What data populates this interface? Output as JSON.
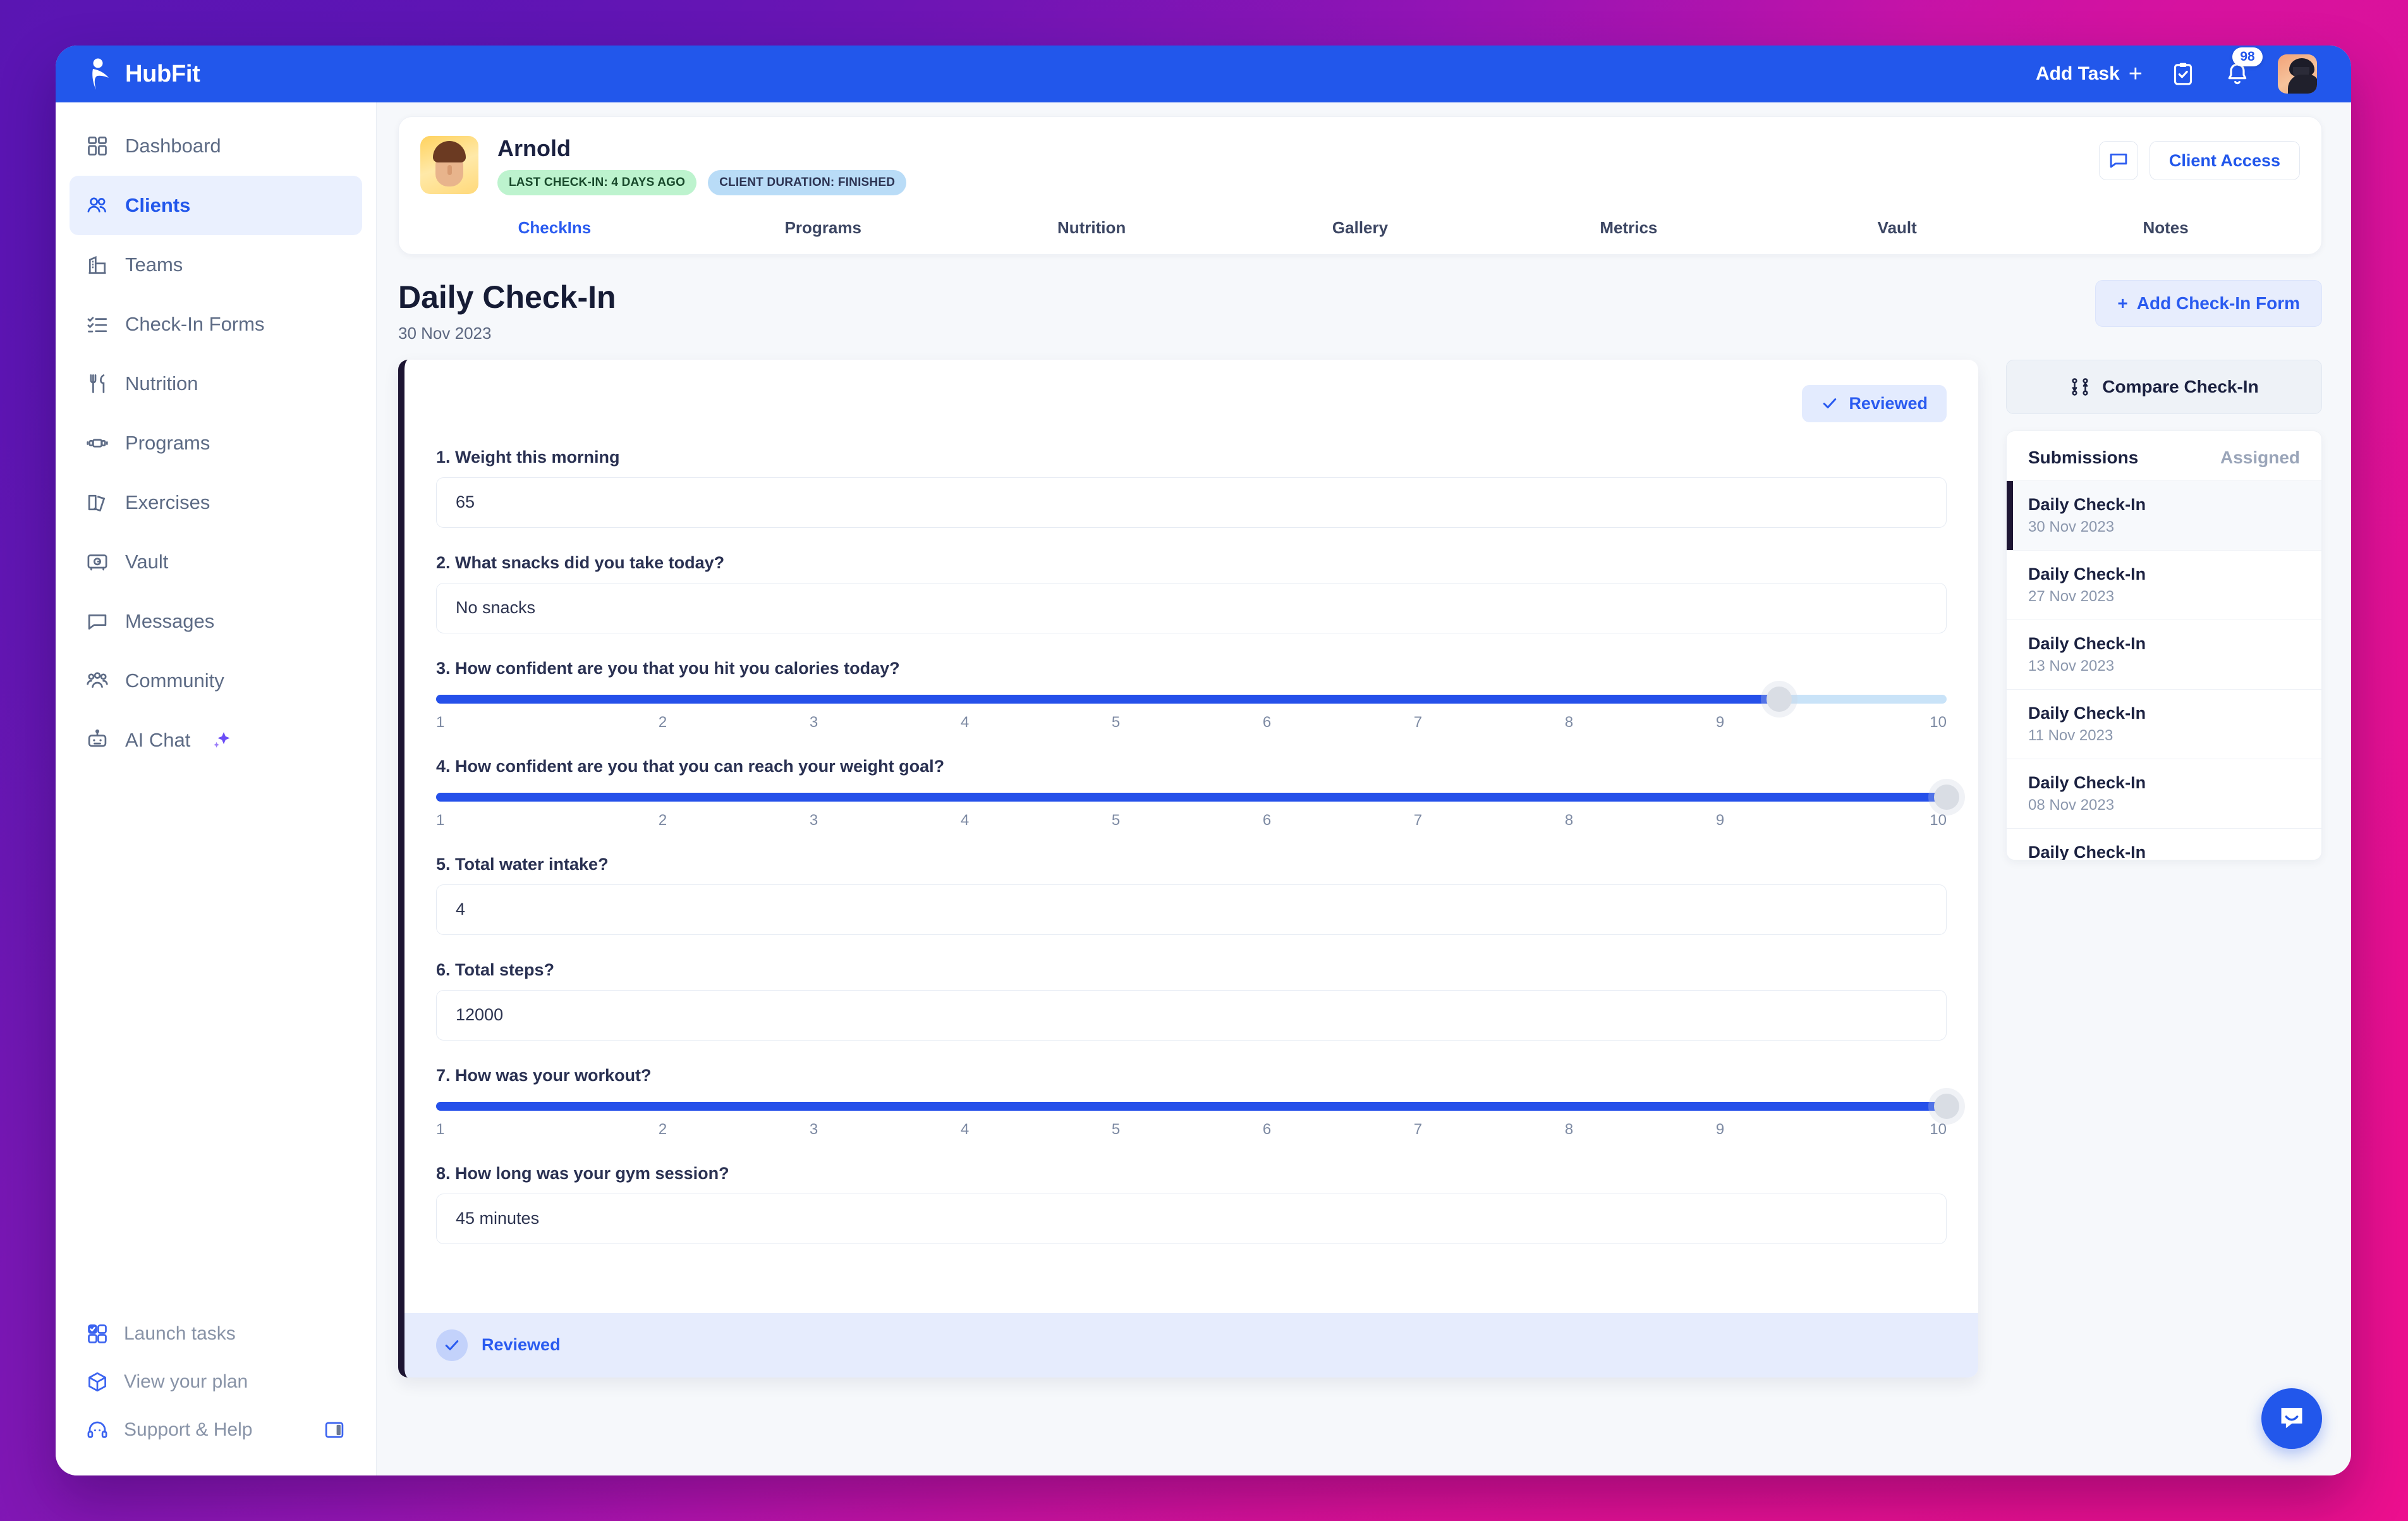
{
  "brand": {
    "name": "HubFit",
    "logo_icon": "runner-logo-icon"
  },
  "topbar": {
    "add_task_label": "Add Task",
    "add_task_plus": "+",
    "tasks_icon": "clipboard-check-icon",
    "notifications_icon": "bell-icon",
    "notification_count": "98",
    "avatar_icon": "user-avatar"
  },
  "sidebar": {
    "items": [
      {
        "label": "Dashboard",
        "icon": "grid-icon",
        "active": false
      },
      {
        "label": "Clients",
        "icon": "users-icon",
        "active": true
      },
      {
        "label": "Teams",
        "icon": "building-icon",
        "active": false
      },
      {
        "label": "Check-In Forms",
        "icon": "checklist-icon",
        "active": false
      },
      {
        "label": "Nutrition",
        "icon": "cutlery-icon",
        "active": false
      },
      {
        "label": "Programs",
        "icon": "dumbbell-icon",
        "active": false
      },
      {
        "label": "Exercises",
        "icon": "book-icon",
        "active": false
      },
      {
        "label": "Vault",
        "icon": "safe-icon",
        "active": false
      },
      {
        "label": "Messages",
        "icon": "chat-bubble-icon",
        "active": false
      },
      {
        "label": "Community",
        "icon": "community-icon",
        "active": false
      },
      {
        "label": "AI Chat",
        "icon": "robot-icon",
        "active": false,
        "sparkle": true
      }
    ],
    "bottom_items": [
      {
        "label": "Launch tasks",
        "icon": "launch-tasks-icon"
      },
      {
        "label": "View your plan",
        "icon": "box-icon"
      },
      {
        "label": "Support & Help",
        "icon": "headset-icon"
      }
    ],
    "collapse_icon": "panel-collapse-icon"
  },
  "client": {
    "name": "Arnold",
    "avatar_icon": "client-avatar",
    "chips": [
      {
        "label": "LAST CHECK-IN: 4 DAYS AGO",
        "tone": "green"
      },
      {
        "label": "CLIENT DURATION: FINISHED",
        "tone": "blue"
      }
    ],
    "message_icon": "chat-bubble-icon",
    "client_access_label": "Client Access",
    "tabs": [
      {
        "label": "CheckIns",
        "active": true
      },
      {
        "label": "Programs",
        "active": false
      },
      {
        "label": "Nutrition",
        "active": false
      },
      {
        "label": "Gallery",
        "active": false
      },
      {
        "label": "Metrics",
        "active": false
      },
      {
        "label": "Vault",
        "active": false
      },
      {
        "label": "Notes",
        "active": false
      }
    ]
  },
  "page": {
    "title": "Daily Check-In",
    "date": "30 Nov 2023",
    "add_form_label": "Add Check-In Form",
    "add_form_plus": "+"
  },
  "form": {
    "reviewed_pill_label": "Reviewed",
    "reviewed_check_icon": "check-icon",
    "footer_label": "Reviewed",
    "questions": [
      {
        "number": "1.",
        "label": "1. Weight this morning",
        "type": "text",
        "value": "65"
      },
      {
        "number": "2.",
        "label": "2. What snacks did you take today?",
        "type": "text",
        "value": "No snacks"
      },
      {
        "number": "3.",
        "label": "3. How confident are you that you hit you calories today?",
        "type": "slider",
        "value": 9,
        "min": 1,
        "max": 10,
        "ticks": [
          "1",
          "2",
          "3",
          "4",
          "5",
          "6",
          "7",
          "8",
          "9",
          "10"
        ]
      },
      {
        "number": "4.",
        "label": "4. How confident are you that you can reach your weight goal?",
        "type": "slider",
        "value": 10,
        "min": 1,
        "max": 10,
        "ticks": [
          "1",
          "2",
          "3",
          "4",
          "5",
          "6",
          "7",
          "8",
          "9",
          "10"
        ]
      },
      {
        "number": "5.",
        "label": "5. Total water intake?",
        "type": "text",
        "value": "4"
      },
      {
        "number": "6.",
        "label": "6. Total steps?",
        "type": "text",
        "value": "12000"
      },
      {
        "number": "7.",
        "label": "7. How was your workout?",
        "type": "slider",
        "value": 10,
        "min": 1,
        "max": 10,
        "ticks": [
          "1",
          "2",
          "3",
          "4",
          "5",
          "6",
          "7",
          "8",
          "9",
          "10"
        ]
      },
      {
        "number": "8.",
        "label": "8. How long was your gym session?",
        "type": "text",
        "value": "45 minutes"
      }
    ]
  },
  "right_panel": {
    "compare_label": "Compare Check-In",
    "compare_icon": "compare-branch-icon",
    "tabs": [
      {
        "label": "Submissions",
        "active": true
      },
      {
        "label": "Assigned",
        "active": false
      }
    ],
    "submissions": [
      {
        "title": "Daily Check-In",
        "date": "30 Nov 2023",
        "active": true
      },
      {
        "title": "Daily Check-In",
        "date": "27 Nov 2023",
        "active": false
      },
      {
        "title": "Daily Check-In",
        "date": "13 Nov 2023",
        "active": false
      },
      {
        "title": "Daily Check-In",
        "date": "11 Nov 2023",
        "active": false
      },
      {
        "title": "Daily Check-In",
        "date": "08 Nov 2023",
        "active": false
      },
      {
        "title": "Daily Check-In",
        "date": "",
        "active": false
      }
    ]
  },
  "intercom": {
    "icon": "intercom-chat-icon"
  },
  "colors": {
    "brand_blue": "#2257eb",
    "accent_blue": "#2a5bf0",
    "slider_fill": "#2550ea",
    "slider_track": "#c9e3f8",
    "dark_accent": "#1d1533",
    "chip_green_bg": "#bdf3ce",
    "chip_blue_bg": "#b9dcf7",
    "page_bg": "#f6f8fb"
  }
}
